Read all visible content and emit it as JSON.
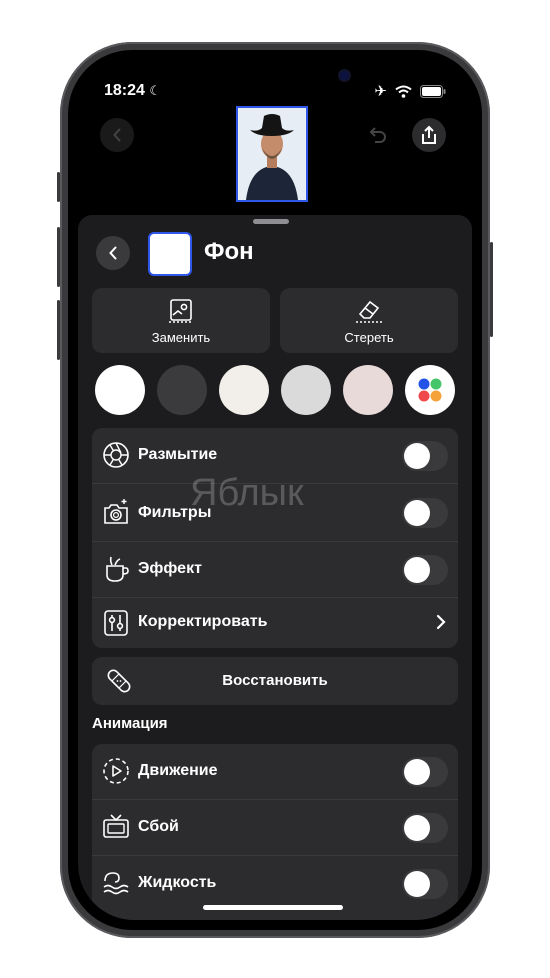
{
  "status_bar": {
    "time": "18:24"
  },
  "sheet": {
    "title": "Фон",
    "actions": [
      {
        "label": "Заменить",
        "icon": "replace-photo-icon"
      },
      {
        "label": "Стереть",
        "icon": "eraser-icon"
      }
    ],
    "color_swatches": [
      {
        "name": "white",
        "hex": "#FFFFFF"
      },
      {
        "name": "dark-gray",
        "hex": "#3B3B3D"
      },
      {
        "name": "off-white",
        "hex": "#F2EFEA"
      },
      {
        "name": "light-gray",
        "hex": "#DADADA"
      },
      {
        "name": "pale-pink",
        "hex": "#E9DADA"
      },
      {
        "name": "more-colors",
        "icon": "color-palette-icon"
      }
    ],
    "options": [
      {
        "label": "Размытие",
        "icon": "aperture-icon",
        "control": "toggle",
        "on": false
      },
      {
        "label": "Фильтры",
        "icon": "filters-icon",
        "control": "toggle",
        "on": false
      },
      {
        "label": "Эффект",
        "icon": "effect-cup-icon",
        "control": "toggle",
        "on": false
      },
      {
        "label": "Корректировать",
        "icon": "sliders-icon",
        "control": "chevron"
      }
    ],
    "restore_label": "Восстановить",
    "animation_heading": "Анимация",
    "animations": [
      {
        "label": "Движение",
        "icon": "play-motion-icon",
        "on": false
      },
      {
        "label": "Сбой",
        "icon": "tv-glitch-icon",
        "on": false
      },
      {
        "label": "Жидкость",
        "icon": "wave-icon",
        "on": false
      }
    ]
  },
  "watermark": "Яблык"
}
